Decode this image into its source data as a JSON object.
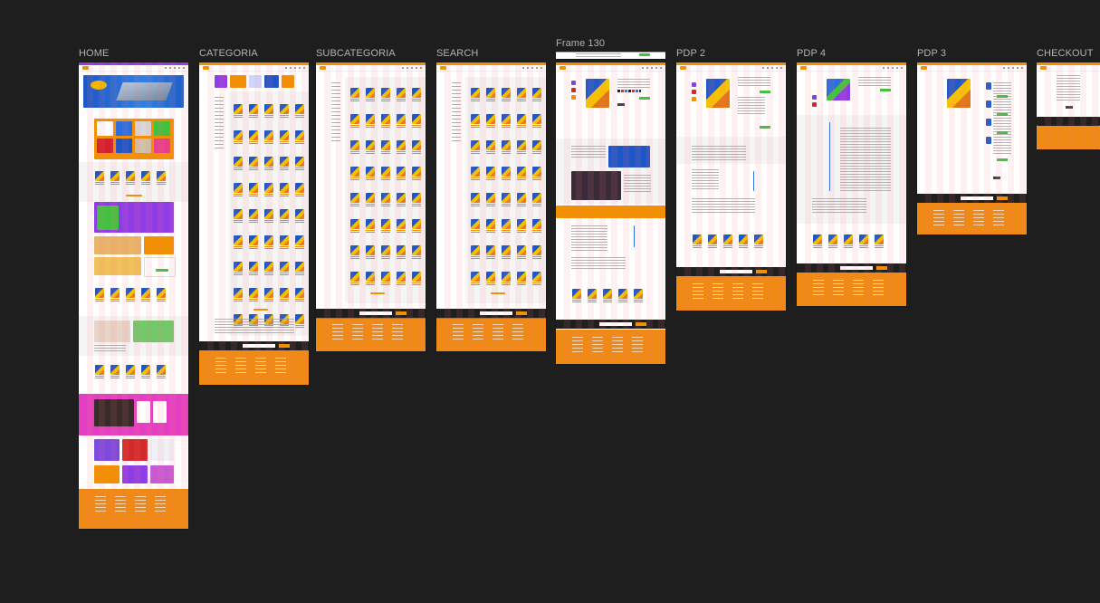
{
  "canvas": {
    "background": "#1e1e1e"
  },
  "frames": [
    {
      "id": "home",
      "label": "HOME"
    },
    {
      "id": "categoria",
      "label": "CATEGORIA"
    },
    {
      "id": "subcategoria",
      "label": "SUBCATEGORIA"
    },
    {
      "id": "search",
      "label": "SEARCH"
    },
    {
      "id": "frame130",
      "label": "Frame 130"
    },
    {
      "id": "pdp2",
      "label": "PDP 2"
    },
    {
      "id": "pdp4",
      "label": "PDP 4"
    },
    {
      "id": "pdp3",
      "label": "PDP 3"
    },
    {
      "id": "checkout",
      "label": "CHECKOUT"
    }
  ],
  "colors": {
    "accent_orange": "#f29100",
    "footer_orange": "#ef8a14",
    "purple": "#8e3ce6",
    "magenta": "#e43fc2",
    "green": "#3fc33f",
    "blue": "#1e56c7",
    "yellow": "#f5c300"
  },
  "icons": {
    "frame_thumbnail": "page-thumbnail-icon",
    "product_card": "product-card-icon"
  }
}
